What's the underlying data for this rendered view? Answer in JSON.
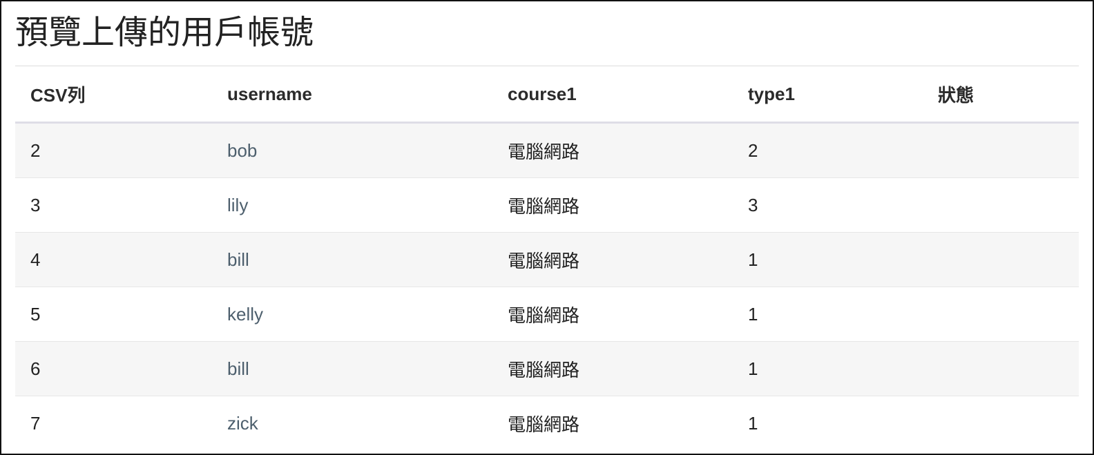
{
  "page": {
    "title": "預覽上傳的用戶帳號"
  },
  "table": {
    "columns": [
      "CSV列",
      "username",
      "course1",
      "type1",
      "狀態"
    ],
    "rows": [
      {
        "csv_row": "2",
        "username": "bob",
        "course1": "電腦網路",
        "type1": "2",
        "status": ""
      },
      {
        "csv_row": "3",
        "username": "lily",
        "course1": "電腦網路",
        "type1": "3",
        "status": ""
      },
      {
        "csv_row": "4",
        "username": "bill",
        "course1": "電腦網路",
        "type1": "1",
        "status": ""
      },
      {
        "csv_row": "5",
        "username": "kelly",
        "course1": "電腦網路",
        "type1": "1",
        "status": ""
      },
      {
        "csv_row": "6",
        "username": "bill",
        "course1": "電腦網路",
        "type1": "1",
        "status": ""
      },
      {
        "csv_row": "7",
        "username": "zick",
        "course1": "電腦網路",
        "type1": "1",
        "status": ""
      }
    ]
  },
  "colors": {
    "stripe": "#f6f6f6",
    "link": "#4d5f6d",
    "header_rule": "#dedde6"
  }
}
